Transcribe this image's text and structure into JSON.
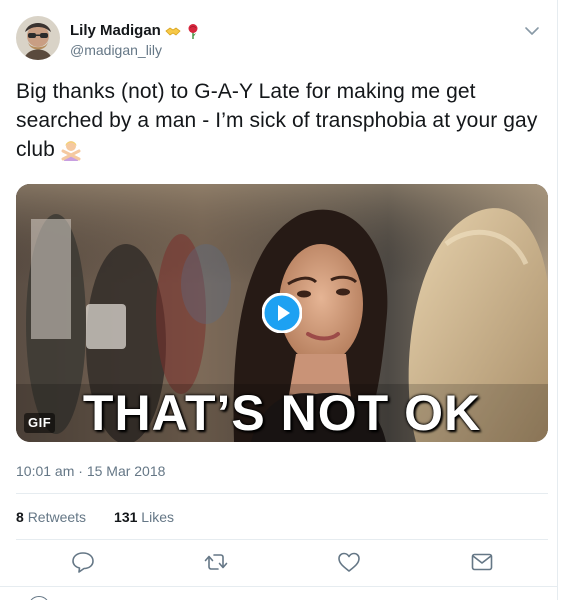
{
  "user": {
    "display_name": "Lily Madigan",
    "handle": "@madigan_lily",
    "badges": [
      "handshake-emoji",
      "rose-emoji"
    ]
  },
  "tweet": {
    "text": "Big thanks (not) to G-A-Y Late for making me get searched by a man - I’m sick of transphobia at your gay club",
    "trailing_emoji": "person-gesturing-no-emoji"
  },
  "media": {
    "type": "gif",
    "badge_label": "GIF",
    "caption": "THAT’S NOT OK",
    "play_icon": "play-icon"
  },
  "meta": {
    "timestamp": "10:01 am · 15 Mar 2018"
  },
  "stats": {
    "retweets_count": "8",
    "retweets_label": "Retweets",
    "likes_count": "131",
    "likes_label": "Likes"
  },
  "actions": [
    "reply-icon",
    "retweet-icon",
    "like-icon",
    "direct-message-icon"
  ],
  "colors": {
    "accent": "#1da1f2",
    "text": "#14171a",
    "muted": "#657786",
    "border": "#e6ecf0"
  }
}
